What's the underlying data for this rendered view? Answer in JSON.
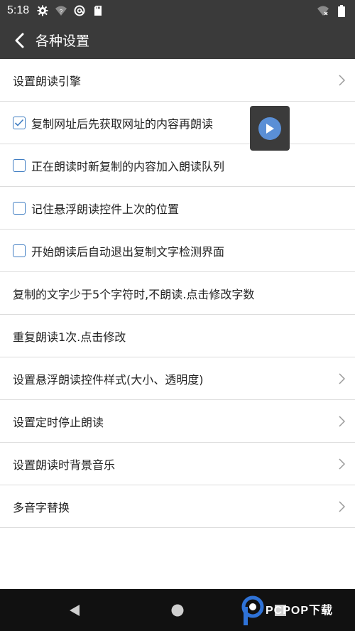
{
  "status_bar": {
    "time": "5:18",
    "icons": [
      "gear-icon",
      "wifi-question-icon",
      "at-sign-icon",
      "sd-card-icon",
      "wifi-x-icon",
      "battery-icon"
    ]
  },
  "app_bar": {
    "title": "各种设置",
    "back_icon": "chevron-left-icon"
  },
  "settings": [
    {
      "label": "设置朗读引擎",
      "type": "link"
    },
    {
      "label": "复制网址后先获取网址的内容再朗读",
      "type": "checkbox",
      "checked": true
    },
    {
      "label": "正在朗读时新复制的内容加入朗读队列",
      "type": "checkbox",
      "checked": false
    },
    {
      "label": "记住悬浮朗读控件上次的位置",
      "type": "checkbox",
      "checked": false
    },
    {
      "label": "开始朗读后自动退出复制文字检测界面",
      "type": "checkbox",
      "checked": false
    },
    {
      "label": "复制的文字少于5个字符时,不朗读.点击修改字数",
      "type": "text"
    },
    {
      "label": "重复朗读1次.点击修改",
      "type": "text"
    },
    {
      "label": "设置悬浮朗读控件样式(大小、透明度)",
      "type": "link"
    },
    {
      "label": "设置定时停止朗读",
      "type": "link"
    },
    {
      "label": "设置朗读时背景音乐",
      "type": "link"
    },
    {
      "label": "多音字替换",
      "type": "link"
    }
  ],
  "float_widget": {
    "icon": "play-icon"
  },
  "nav_bar": {
    "icons": [
      "back-triangle-icon",
      "home-circle-icon",
      "recents-square-icon"
    ]
  },
  "watermark": {
    "text": "PCPOP下载"
  },
  "colors": {
    "bar_bg": "#3a3a3a",
    "accent": "#3f7dc2",
    "divider": "#dcdcdc",
    "nav_bg": "#111111"
  }
}
